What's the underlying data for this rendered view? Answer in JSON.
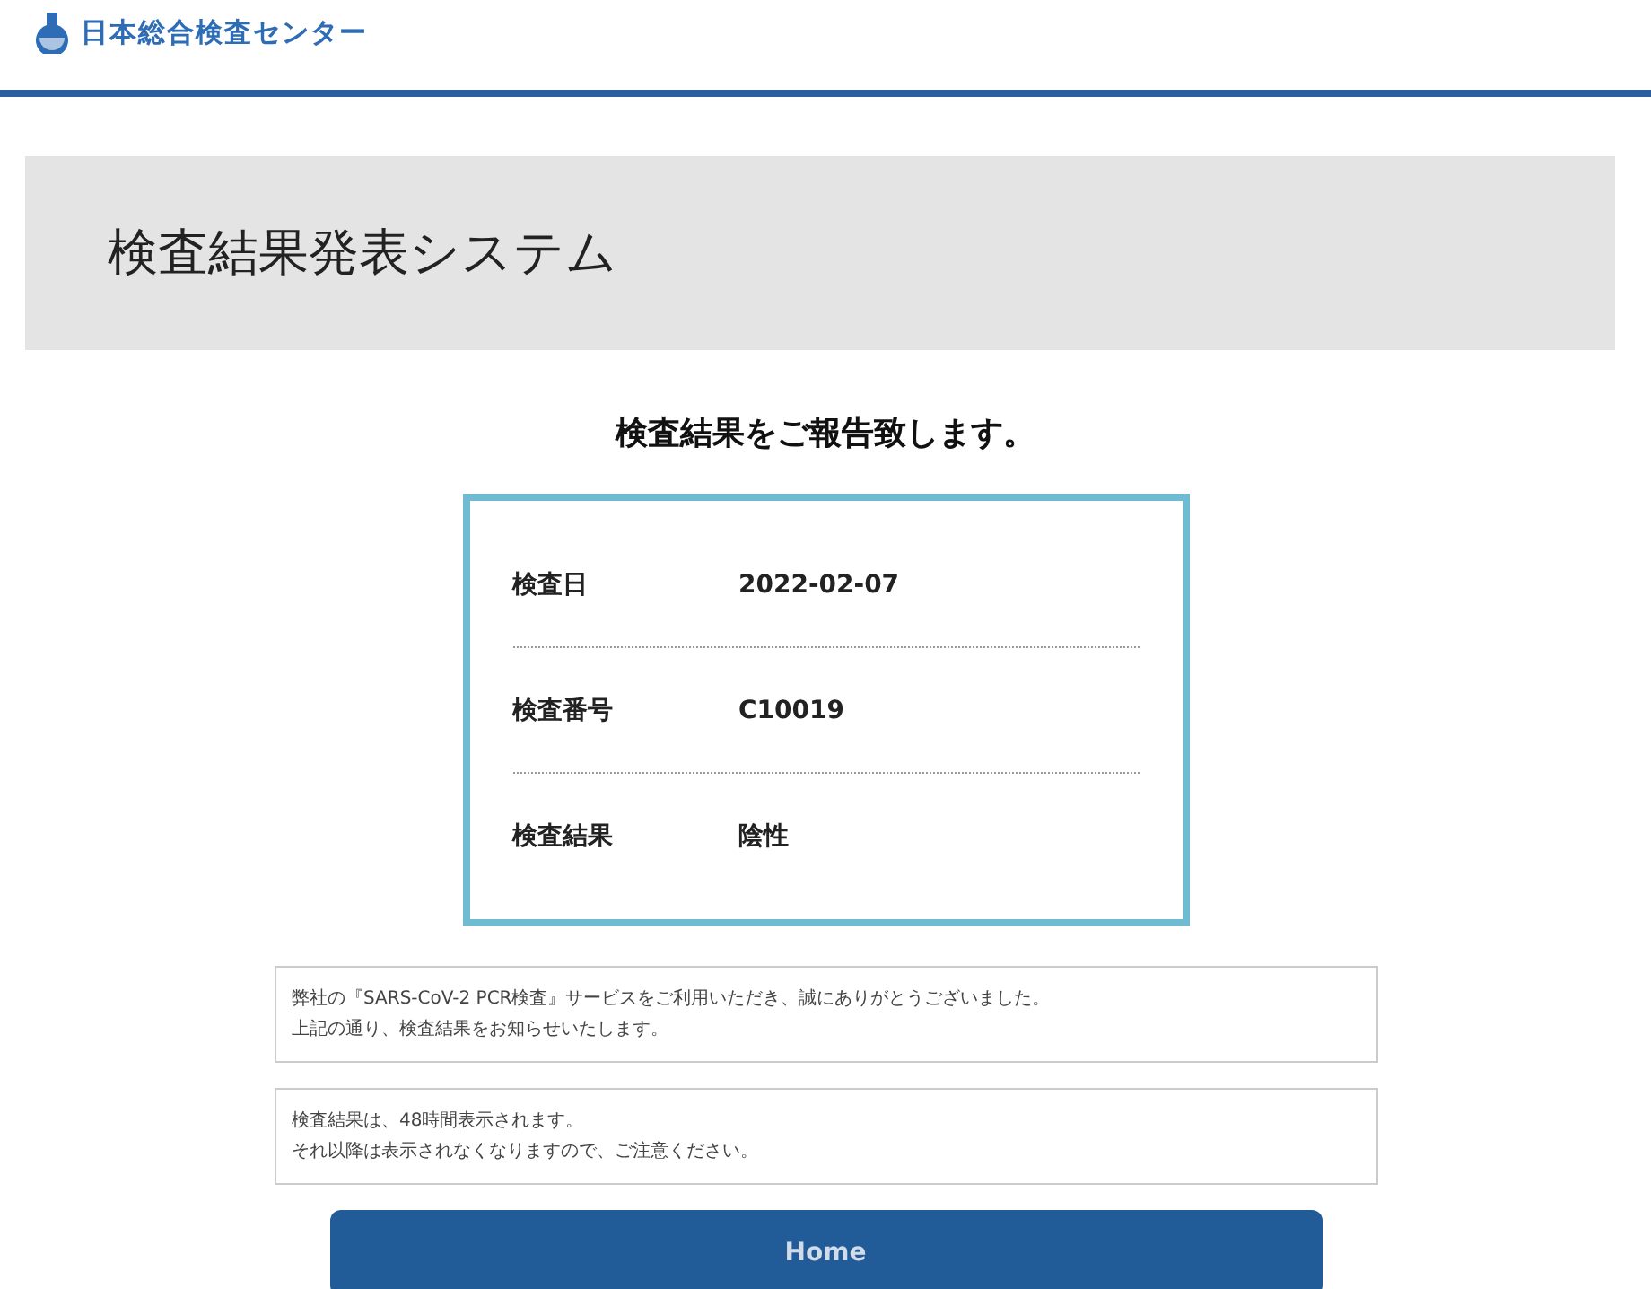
{
  "header": {
    "logo_text": "日本総合検査センター"
  },
  "banner": {
    "title": "検査結果発表システム"
  },
  "heading": "検査結果をご報告致します。",
  "results": [
    {
      "label": "検査日",
      "value": "2022-02-07"
    },
    {
      "label": "検査番号",
      "value": "C10019"
    },
    {
      "label": "検査結果",
      "value": "陰性"
    }
  ],
  "notes": [
    [
      "弊社の『SARS-CoV-2 PCR検査』サービスをご利用いただき、誠にありがとうございました。",
      "上記の通り、検査結果をお知らせいたします。"
    ],
    [
      "検査結果は、48時間表示されます。",
      "それ以降は表示されなくなりますので、ご注意ください。"
    ]
  ],
  "button": {
    "label": "Home"
  }
}
